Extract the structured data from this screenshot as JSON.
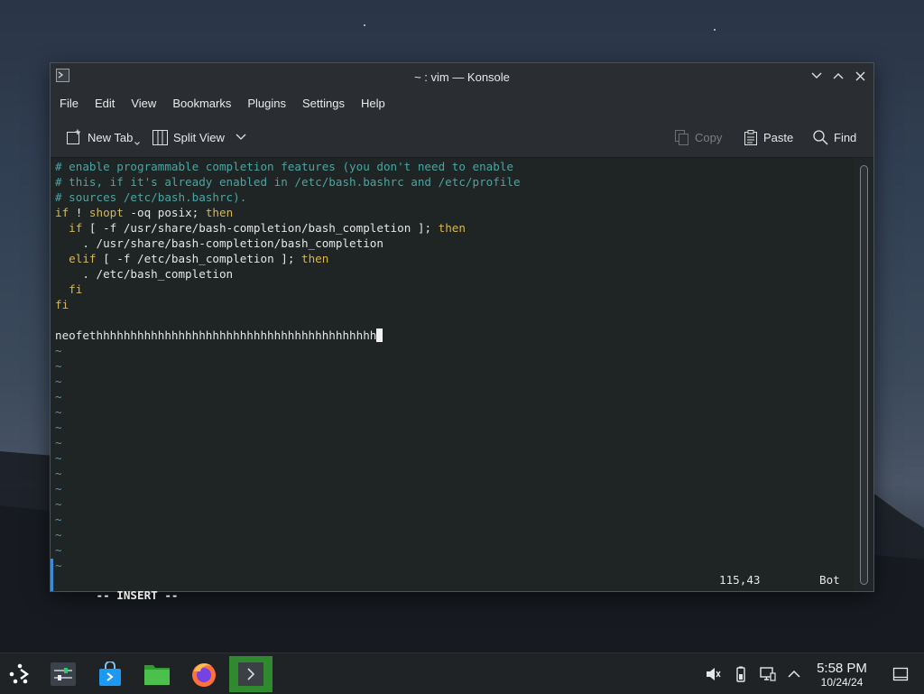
{
  "window": {
    "title": "~ : vim — Konsole"
  },
  "menubar": [
    "File",
    "Edit",
    "View",
    "Bookmarks",
    "Plugins",
    "Settings",
    "Help"
  ],
  "toolbar": {
    "new_tab": "New Tab",
    "split_view": "Split View",
    "copy": "Copy",
    "paste": "Paste",
    "find": "Find"
  },
  "terminal": {
    "lines": [
      "# enable programmable completion features (you don't need to enable",
      "# this, if it's already enabled in /etc/bash.bashrc and /etc/profile",
      "# sources /etc/bash.bashrc).",
      "if ! shopt -oq posix; then",
      "  if [ -f /usr/share/bash-completion/bash_completion ]; then",
      "    . /usr/share/bash-completion/bash_completion",
      "  elif [ -f /etc/bash_completion ]; then",
      "    . /etc/bash_completion",
      "  fi",
      "fi",
      "",
      "neofethhhhhhhhhhhhhhhhhhhhhhhhhhhhhhhhhhhhhhhhh"
    ],
    "tilde": "~",
    "tilde_count": 15,
    "mode": "-- INSERT --",
    "position": "115,43",
    "scroll": "Bot"
  },
  "taskbar": {
    "apps": [
      "app-launcher",
      "system-settings",
      "discover",
      "dolphin",
      "firefox",
      "konsole"
    ],
    "time": "5:58 PM",
    "date": "10/24/24"
  },
  "colors": {
    "comment": "#4aa5a4",
    "keyword": "#d8b84e",
    "tilde": "#5c8fa8",
    "active_task": "#2f8a2f",
    "accent": "#3b8dd6"
  }
}
